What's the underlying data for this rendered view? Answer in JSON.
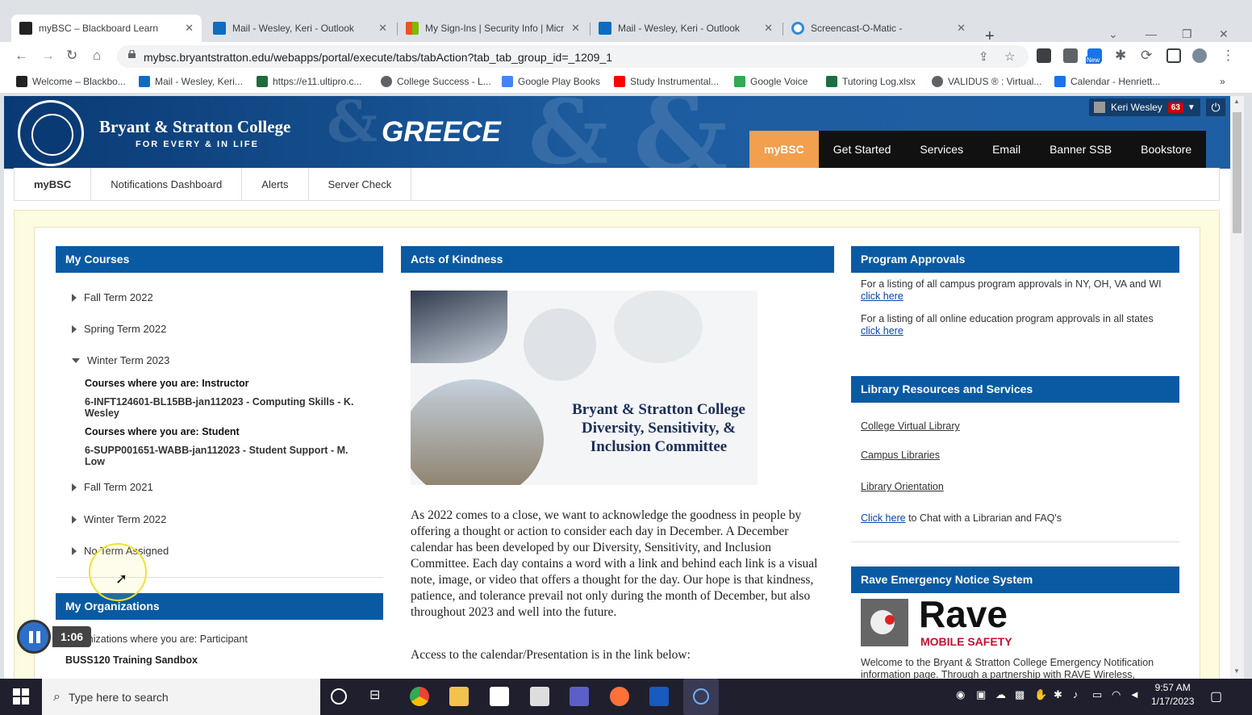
{
  "browser": {
    "tabs": [
      {
        "title": "myBSC – Blackboard Learn",
        "active": true
      },
      {
        "title": "Mail - Wesley, Keri - Outlook",
        "active": false
      },
      {
        "title": "My Sign-Ins | Security Info | Micr",
        "active": false
      },
      {
        "title": "Mail - Wesley, Keri - Outlook",
        "active": false
      },
      {
        "title": "Screencast-O-Matic -",
        "active": false
      }
    ],
    "url": "mybsc.bryantstratton.edu/webapps/portal/execute/tabs/tabAction?tab_tab_group_id=_1209_1",
    "bookmarks": [
      "Welcome – Blackbo...",
      "Mail - Wesley, Keri...",
      "https://e11.ultipro.c...",
      "College Success - L...",
      "Google Play Books",
      "Study Instrumental...",
      "Google Voice",
      "Tutoring Log.xlsx",
      "VALIDUS ® : Virtual...",
      "Calendar - Henriett..."
    ],
    "extension_badge": "New"
  },
  "site": {
    "college_name": "Bryant & Stratton College",
    "tagline": "FOR EVERY & IN LIFE",
    "campus": "GREECE",
    "user_name": "Keri Wesley",
    "notification_count": "63",
    "main_nav": [
      "myBSC",
      "Get Started",
      "Services",
      "Email",
      "Banner SSB",
      "Bookstore"
    ],
    "sub_tabs": [
      "myBSC",
      "Notifications Dashboard",
      "Alerts",
      "Server Check"
    ]
  },
  "my_courses": {
    "title": "My Courses",
    "terms": [
      "Fall Term 2022",
      "Spring Term 2022",
      "Winter Term 2023",
      "Fall Term 2021",
      "Winter Term 2022",
      "No Term Assigned"
    ],
    "instructor_label": "Courses where you are: Instructor",
    "instructor_course": "6-INFT124601-BL15BB-jan112023 - Computing Skills - K. Wesley",
    "student_label": "Courses where you are: Student",
    "student_course": "6-SUPP001651-WABB-jan112023 - Student Support - M. Low"
  },
  "my_orgs": {
    "title": "My Organizations",
    "role_label": "Organizations where you are: Participant",
    "org": "BUSS120 Training Sandbox"
  },
  "kindness": {
    "title": "Acts of Kindness",
    "image_caption_1": "Bryant & Stratton College",
    "image_caption_2": "Diversity, Sensitivity, &",
    "image_caption_3": "Inclusion Committee",
    "body": "As 2022 comes to a close, we want to acknowledge the goodness in people by offering a thought or action to consider each day in December.  A December calendar has been developed by our Diversity, Sensitivity, and Inclusion Committee. Each day contains a word with a link and behind each link is a visual note, image, or video that offers a thought for the day.  Our hope is that kindness, patience, and tolerance prevail not only during the month of December, but also throughout 2023 and well into the future.",
    "access": "Access to the calendar/Presentation is in the link below:"
  },
  "program_approvals": {
    "title": "Program Approvals",
    "item1_text": "For a listing of all campus program approvals in NY, OH, VA and WI",
    "item1_link": "click here",
    "item2_text": "For a listing of all online education program approvals in all states",
    "item2_link": "click here"
  },
  "library": {
    "title": "Library Resources and Services",
    "links": [
      "College Virtual Library",
      "Campus Libraries",
      "Library Orientation"
    ],
    "chat_link": "Click here",
    "chat_text": "to Chat with a Librarian and FAQ's"
  },
  "rave": {
    "title": "Rave Emergency Notice System",
    "logo_text": "Rave",
    "logo_sub": "MOBILE SAFETY",
    "body": "Welcome to the Bryant & Stratton College Emergency Notification information page. Through a partnership with RAVE Wireless,"
  },
  "recorder": {
    "elapsed": "1:06"
  },
  "taskbar": {
    "search_placeholder": "Type here to search",
    "time": "9:57 AM",
    "date": "1/17/2023"
  }
}
